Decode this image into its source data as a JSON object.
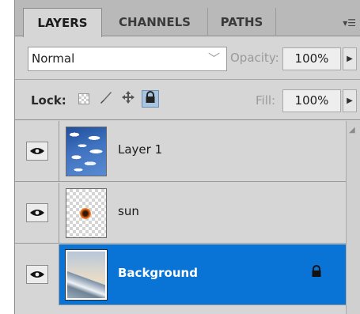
{
  "tabs": [
    {
      "label": "LAYERS"
    },
    {
      "label": "CHANNELS"
    },
    {
      "label": "PATHS"
    }
  ],
  "blend_mode": {
    "value": "Normal"
  },
  "opacity": {
    "label": "Opacity:",
    "value": "100%"
  },
  "lock": {
    "label": "Lock:"
  },
  "fill": {
    "label": "Fill:",
    "value": "100%"
  },
  "layers": [
    {
      "name": "Layer 1",
      "thumbnail": "clouds",
      "selected": false
    },
    {
      "name": "sun",
      "thumbnail": "sun-on-transparent",
      "selected": false
    },
    {
      "name": "Background",
      "thumbnail": "sky-mountain",
      "selected": true,
      "locked": true
    }
  ],
  "colors": {
    "panel_bg": "#d6d6d6",
    "selected_row": "#0a73d6",
    "tab_strip": "#b9b9b9"
  }
}
